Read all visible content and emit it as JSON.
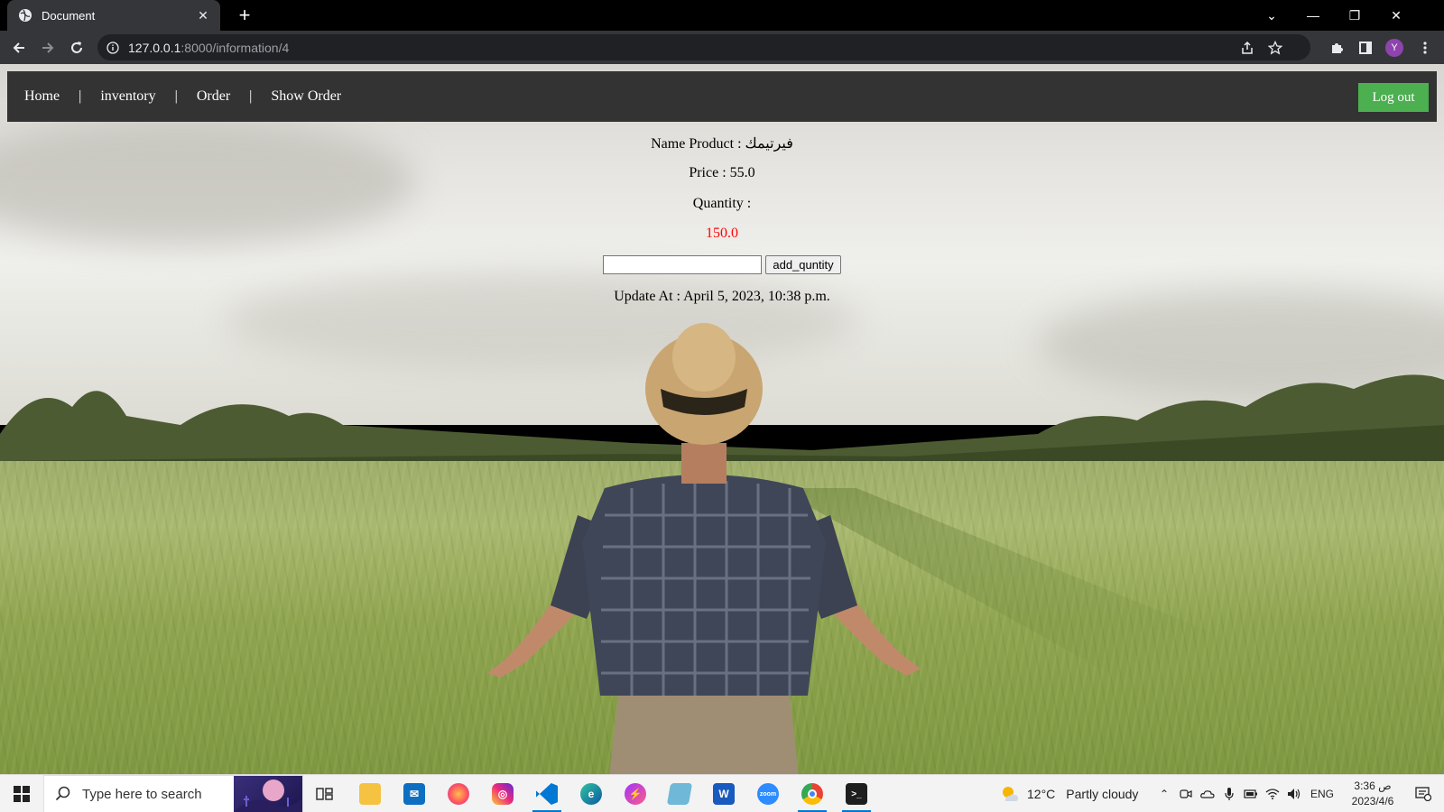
{
  "browser": {
    "tab_title": "Document",
    "tab_close": "✕",
    "new_tab": "+",
    "url_host": "127.0.0.1",
    "url_rest": ":8000/information/4",
    "window_controls": {
      "dropdown": "⌄",
      "minimize": "—",
      "restore": "❐",
      "close": "✕"
    }
  },
  "nav": {
    "links": [
      "Home",
      "inventory",
      "Order",
      "Show Order"
    ],
    "separator": "|",
    "logout": "Log out"
  },
  "product": {
    "name_line": "Name Product : فيرتيمك",
    "price_line": "Price : 55.0",
    "quantity_label": "Quantity :",
    "quantity_value": "150.0",
    "input_value": "",
    "add_button": "add_quntity",
    "updated_line": "Update At : April 5, 2023, 10:38 p.m."
  },
  "taskbar": {
    "search_placeholder": "Type here to search",
    "weather_temp": "12°C",
    "weather_desc": "Partly cloudy",
    "language": "ENG",
    "time": "3:36 ص",
    "date": "2023/4/6",
    "apps": [
      "task-view",
      "file-explorer",
      "mail",
      "firefox",
      "instagram",
      "vscode",
      "edge",
      "messenger",
      "notepad",
      "word",
      "zoom",
      "chrome",
      "terminal"
    ]
  },
  "colors": {
    "navbar": "#333333",
    "logout": "#4caf50",
    "quantity_value": "#ff0000",
    "browser_frame": "#35363a"
  }
}
